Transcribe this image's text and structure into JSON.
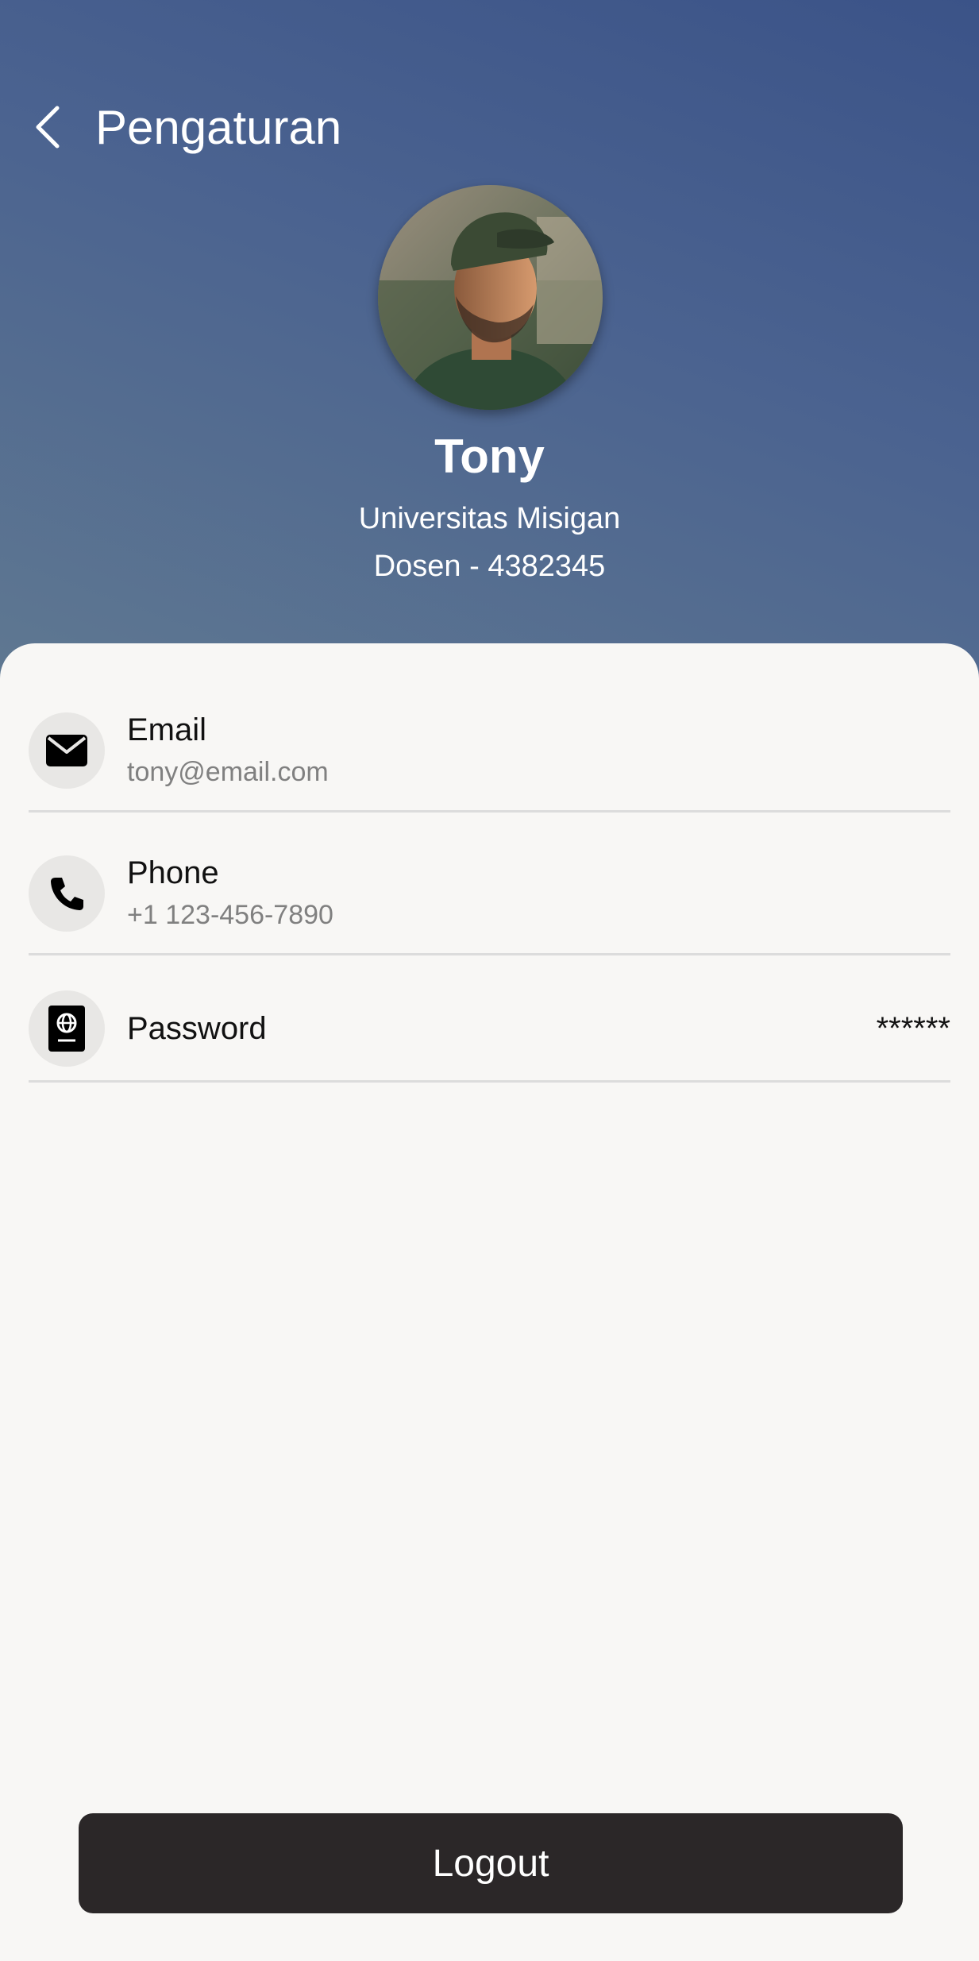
{
  "header": {
    "title": "Pengaturan"
  },
  "profile": {
    "name": "Tony",
    "university": "Universitas Misigan",
    "role_id": "Dosen - 4382345"
  },
  "settings": {
    "email": {
      "label": "Email",
      "value": "tony@email.com",
      "icon": "envelope-icon"
    },
    "phone": {
      "label": "Phone",
      "value": "+1 123-456-7890",
      "icon": "phone-icon"
    },
    "password": {
      "label": "Password",
      "value": "******",
      "icon": "passport-icon"
    }
  },
  "logout_label": "Logout",
  "colors": {
    "header_gradient_top": "#3b5388",
    "header_gradient_bottom": "#5f7891",
    "card_background": "#f8f7f5",
    "logout_button": "#2b2728"
  }
}
